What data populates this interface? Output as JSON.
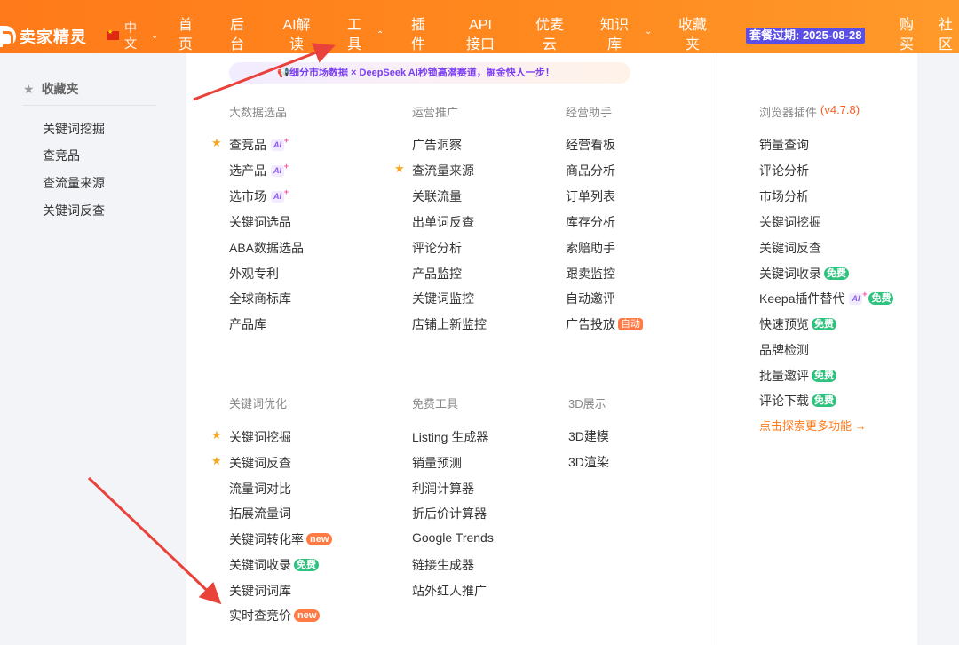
{
  "header": {
    "logo_text": "卖家精灵",
    "lang": "中文",
    "nav": [
      "首页",
      "后台",
      "AI解读",
      "工具",
      "插件",
      "API接口",
      "优麦云",
      "知识库",
      "收藏夹"
    ],
    "expire": "套餐过期: 2025-08-28",
    "buy": "购买",
    "community": "社区"
  },
  "sidebar": {
    "title": "收藏夹",
    "items": [
      "关键词挖掘",
      "查竞品",
      "查流量来源",
      "关键词反查"
    ]
  },
  "banner": "细分市场数据 × DeepSeek AI秒锁高潜赛道，掘金快人一步！",
  "tags": {
    "ai": "AI",
    "free": "免费",
    "new": "new",
    "auto": "自动"
  },
  "columns": {
    "bigdata": {
      "title": "大数据选品",
      "items": [
        "查竞品",
        "选产品",
        "选市场",
        "关键词选品",
        "ABA数据选品",
        "外观专利",
        "全球商标库",
        "产品库"
      ]
    },
    "ops": {
      "title": "运营推广",
      "items": [
        "广告洞察",
        "查流量来源",
        "关联流量",
        "出单词反查",
        "评论分析",
        "产品监控",
        "关键词监控",
        "店铺上新监控"
      ]
    },
    "assistant": {
      "title": "经营助手",
      "items": [
        "经营看板",
        "商品分析",
        "订单列表",
        "库存分析",
        "索赔助手",
        "跟卖监控",
        "自动邀评",
        "广告投放"
      ]
    },
    "keyword": {
      "title": "关键词优化",
      "items": [
        "关键词挖掘",
        "关键词反查",
        "流量词对比",
        "拓展流量词",
        "关键词转化率",
        "关键词收录",
        "关键词词库",
        "实时查竞价"
      ]
    },
    "free": {
      "title": "免费工具",
      "items": [
        "Listing 生成器",
        "销量预测",
        "利润计算器",
        "折后价计算器",
        "Google Trends",
        "链接生成器",
        "站外红人推广"
      ]
    },
    "d3": {
      "title": "3D展示",
      "items": [
        "3D建模",
        "3D渲染"
      ]
    },
    "plugin": {
      "title": "浏览器插件",
      "version": "(v4.7.8)",
      "items": [
        "销量查询",
        "评论分析",
        "市场分析",
        "关键词挖掘",
        "关键词反查",
        "关键词收录",
        "Keepa插件替代",
        "快速预览",
        "品牌检测",
        "批量邀评",
        "评论下载"
      ],
      "more": "点击探索更多功能 →"
    }
  }
}
